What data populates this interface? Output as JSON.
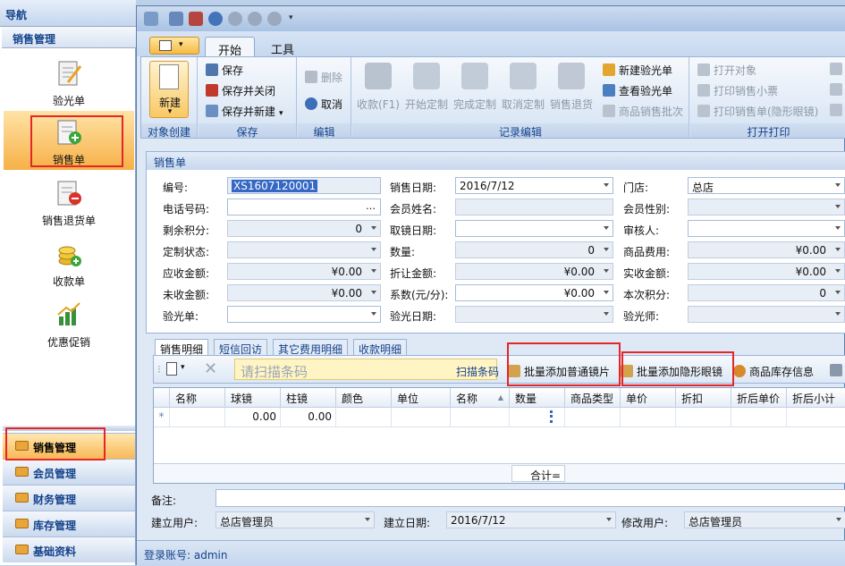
{
  "nav": {
    "title": "导航",
    "section": "销售管理",
    "items": [
      {
        "label": "验光单",
        "icon": "prescription-pen-icon"
      },
      {
        "label": "销售单",
        "icon": "sales-order-add-icon"
      },
      {
        "label": "销售退货单",
        "icon": "sales-return-remove-icon"
      },
      {
        "label": "收款单",
        "icon": "coins-add-icon"
      },
      {
        "label": "优惠促销",
        "icon": "chart-promotion-icon"
      }
    ],
    "groups": [
      "销售管理",
      "会员管理",
      "财务管理",
      "库存管理",
      "基础资料"
    ]
  },
  "ribbon": {
    "tabs": [
      "开始",
      "工具"
    ],
    "groups": {
      "create": {
        "label": "对象创建",
        "new_label": "新建"
      },
      "save": {
        "label": "保存",
        "save": "保存",
        "save_close": "保存并关闭",
        "save_new": "保存并新建"
      },
      "edit": {
        "label": "编辑",
        "delete": "删除",
        "cancel": "取消"
      },
      "record": {
        "label": "记录编辑",
        "buttons": [
          "收款(F1)",
          "开始定制",
          "完成定制",
          "取消定制",
          "销售退货"
        ],
        "new_prescription": "新建验光单",
        "view_prescription": "查看验光单",
        "batch": "商品销售批次"
      },
      "print": {
        "label": "打开打印",
        "open": "打开对象",
        "print_receipt": "打印销售小票",
        "print_contact": "打印销售单(隐形眼镜)"
      }
    }
  },
  "form": {
    "header": "销售单",
    "fields": {
      "number": {
        "label": "编号:",
        "value": "XS1607120001"
      },
      "sale_date": {
        "label": "销售日期:",
        "value": "2016/7/12"
      },
      "store": {
        "label": "门店:",
        "value": "总店"
      },
      "phone": {
        "label": "电话号码:",
        "value": ""
      },
      "member_name": {
        "label": "会员姓名:",
        "value": ""
      },
      "member_gender": {
        "label": "会员性别:",
        "value": ""
      },
      "points_left": {
        "label": "剩余积分:",
        "value": "0"
      },
      "pickup_date": {
        "label": "取镜日期:",
        "value": ""
      },
      "reviewer": {
        "label": "审核人:",
        "value": ""
      },
      "custom_status": {
        "label": "定制状态:",
        "value": ""
      },
      "quantity": {
        "label": "数量:",
        "value": "0"
      },
      "goods_fee": {
        "label": "商品费用:",
        "value": "¥0.00"
      },
      "receivable": {
        "label": "应收金额:",
        "value": "¥0.00"
      },
      "discount_amount": {
        "label": "折让金额:",
        "value": "¥0.00"
      },
      "received": {
        "label": "实收金额:",
        "value": "¥0.00"
      },
      "unreceived": {
        "label": "未收金额:",
        "value": "¥0.00"
      },
      "coefficient": {
        "label": "系数(元/分):",
        "value": "¥0.00"
      },
      "points_this": {
        "label": "本次积分:",
        "value": "0"
      },
      "prescription": {
        "label": "验光单:",
        "value": ""
      },
      "prescription_date": {
        "label": "验光日期:",
        "value": ""
      },
      "optometrist": {
        "label": "验光师:",
        "value": ""
      }
    }
  },
  "detail": {
    "tabs": [
      "销售明细",
      "短信回访",
      "其它费用明细",
      "收款明细"
    ],
    "scan_placeholder": "请扫描条码",
    "scan_label": "扫描条码",
    "batch_normal": "批量添加普通镜片",
    "batch_contact": "批量添加隐形眼镜",
    "stock_info": "商品库存信息",
    "columns": [
      "名称",
      "球镜",
      "柱镜",
      "颜色",
      "单位",
      "名称",
      "数量",
      "商品类型",
      "单价",
      "折扣",
      "折后单价",
      "折后小计"
    ],
    "new_row": {
      "sphere": "0.00",
      "cylinder": "0.00"
    },
    "total_label": "合计="
  },
  "footer": {
    "note_label": "备注:",
    "creator_label": "建立用户:",
    "creator": "总店管理员",
    "created_date_label": "建立日期:",
    "created_date": "2016/7/12",
    "modifier_label": "修改用户:",
    "modifier": "总店管理员"
  },
  "status": {
    "login": "登录账号: admin"
  }
}
